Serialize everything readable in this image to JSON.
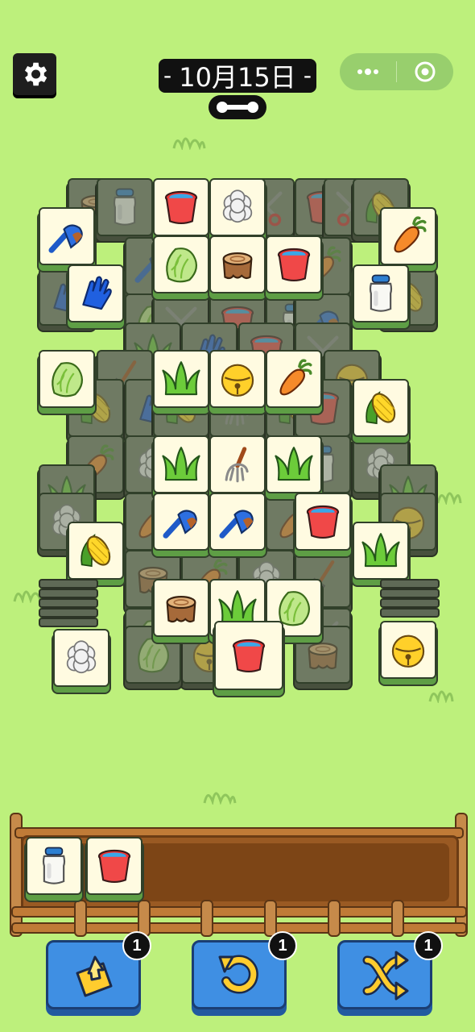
{
  "header": {
    "date": "10月15日",
    "dash_left": "-",
    "dash_right": "-",
    "settings_icon": "gear-icon",
    "capsule": {
      "more_icon": "more-dots-icon",
      "close_icon": "record-circle-icon"
    }
  },
  "board": {
    "tile_types": [
      "brush",
      "glove",
      "cabbage",
      "bucket",
      "cotton",
      "stump",
      "carrot",
      "milk",
      "corn",
      "grass",
      "bell",
      "fork",
      "shovel",
      "scissors"
    ]
  },
  "tray": {
    "capacity": 7,
    "items": [
      "milk",
      "bucket"
    ]
  },
  "tools": [
    {
      "name": "shuffle-out",
      "icon": "tile-lift-icon",
      "count": "1"
    },
    {
      "name": "undo",
      "icon": "undo-icon",
      "count": "1"
    },
    {
      "name": "shuffle",
      "icon": "shuffle-icon",
      "count": "1"
    }
  ],
  "colors": {
    "background": "#bdf07c",
    "tile_face": "#fffbe1",
    "tile_edge": "#5e9e45",
    "tool_blue": "#3f8fe3"
  }
}
